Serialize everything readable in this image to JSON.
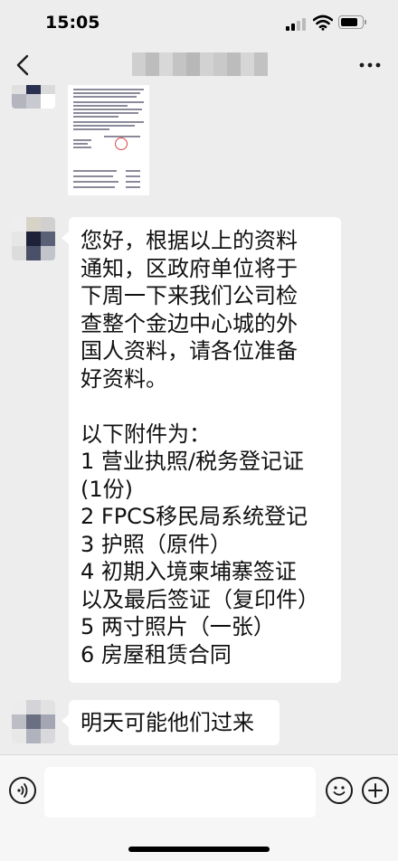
{
  "status_bar": {
    "time": "15:05",
    "icons": [
      "signal-icon",
      "wifi-icon",
      "battery-icon"
    ]
  },
  "nav": {
    "back_icon": "chevron-left-icon",
    "title_obscured": true,
    "more_icon": "more-dots-icon"
  },
  "messages": [
    {
      "type": "image",
      "sender": "other",
      "description_icon": "document-image"
    },
    {
      "type": "text",
      "sender": "other",
      "lines": [
        "您好，根据以上的资料",
        "通知，区政府单位将于",
        "下周一下来我们公司检",
        "查整个金边中心城的外",
        "国人资料，请各位准备",
        "好资料。",
        "",
        "以下附件为：",
        "1 营业执照/税务登记证",
        "(1份)",
        "2 FPCS移民局系统登记",
        "3 护照（原件）",
        "4 初期入境柬埔寨签证",
        "以及最后签证（复印件）",
        "5 两寸照片（一张）",
        "6 房屋租赁合同"
      ]
    },
    {
      "type": "text",
      "sender": "other",
      "lines": [
        "明天可能他们过来"
      ]
    }
  ],
  "input_bar": {
    "voice_icon": "voice-icon",
    "input_value": "",
    "emoji_icon": "emoji-icon",
    "plus_icon": "plus-icon"
  },
  "colors": {
    "background": "#ededed",
    "bubble": "#ffffff",
    "text": "#111111"
  }
}
